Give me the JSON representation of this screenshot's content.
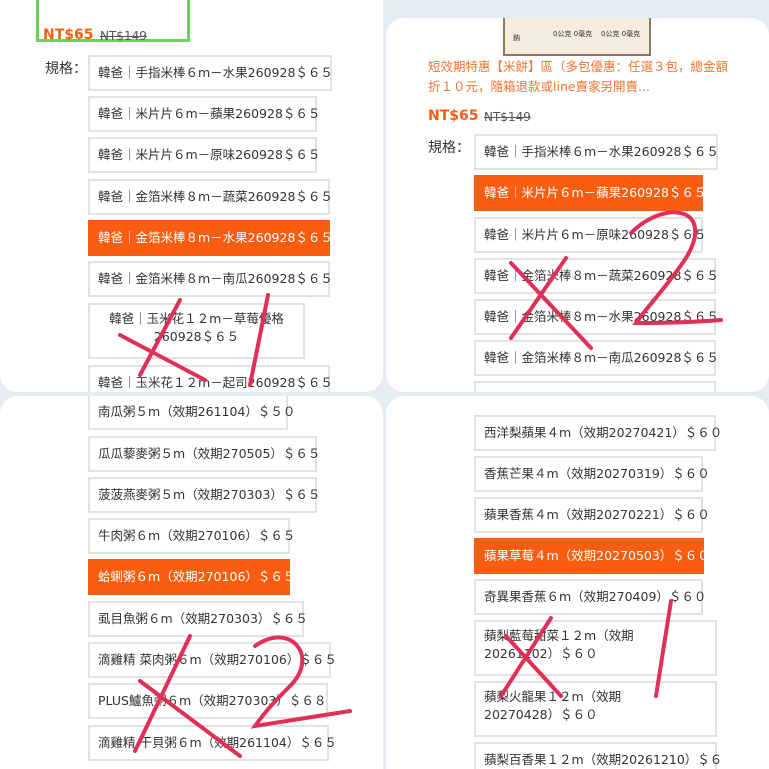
{
  "panel1": {
    "price": "NT$65",
    "old_price": "NT$149",
    "spec_label": "規格：",
    "options": [
      "韓爸｜手指米棒６m－水果260928＄６５",
      "韓爸｜米片片６m－蘋果260928＄６５",
      "韓爸｜米片片６m－原味260928＄６５",
      "韓爸｜金箔米棒８m－蔬菜260928＄６５",
      "韓爸｜金箔米棒８m－水果260928＄６５",
      "韓爸｜金箔米棒８m－南瓜260928＄６５",
      "韓爸｜玉米花１２m－草莓優格 260928＄６５",
      "韓爸｜玉米花１２m－起司260928＄６５"
    ],
    "selected_index": 4
  },
  "panel2": {
    "nutrition": [
      "鈉",
      "0公克 0毫克",
      "0公克 0毫克"
    ],
    "promo": "短效期特惠【米餅】區（多包優惠：任選３包，總金額折１０元，隨箱退款或line賣家另開賣...",
    "price": "NT$65",
    "old_price": "NT$149",
    "spec_label": "規格：",
    "options": [
      "韓爸｜手指米棒６m－水果260928＄６５",
      "韓爸｜米片片６m－蘋果260928＄６５",
      "韓爸｜米片片６m－原味260928＄６５",
      "韓爸｜金箔米棒８m－蔬菜260928＄６５",
      "韓爸｜金箔米棒８m－水果260928＄６５",
      "韓爸｜金箔米棒８m－南瓜260928＄６５"
    ],
    "selected_index": 1
  },
  "panel3": {
    "options": [
      "南瓜粥５m（效期261104）＄５０",
      "瓜瓜藜麥粥５m（效期270505）＄６５",
      "菠菠燕麥粥５m（效期270303）＄６５",
      "牛肉粥６m（效期270106）＄６５",
      "蛤蜊粥６m（效期270106）＄６５",
      "虱目魚粥６m（效期270303）＄６５",
      "滴雞精 菜肉粥６m（效期270106）＄６５",
      "PLUS鱸魚粥６m（效期270303）＄６８",
      "滴雞精 干貝粥６m（效期261104）＄６５"
    ],
    "selected_index": 4
  },
  "panel4": {
    "options": [
      "西洋梨蘋果４m（效期20270421）＄６０",
      "香蕉芒果４m（效期20270319）＄６０",
      "蘋果香蕉４m（效期20270221）＄６０",
      "蘋果草莓４m（效期20270503）＄６０",
      "奇異果香蕉６m（效期270409）＄６０",
      "蘋梨藍莓甜菜１２m（效期20261102）＄６０",
      "蘋梨火龍果１２m（效期20270428）＄６０",
      "蘋梨百香果１２m（效期20261210）＄６"
    ],
    "selected_index": 3
  },
  "annotations": {
    "mark1": "X 1",
    "mark2": "X 2",
    "mark3": "X 2",
    "mark4": "X 1"
  },
  "colors": {
    "accent": "#f95d11",
    "promo_text": "#f37433",
    "highlight_box": "#6ad15a",
    "handwriting": "#e03058"
  }
}
